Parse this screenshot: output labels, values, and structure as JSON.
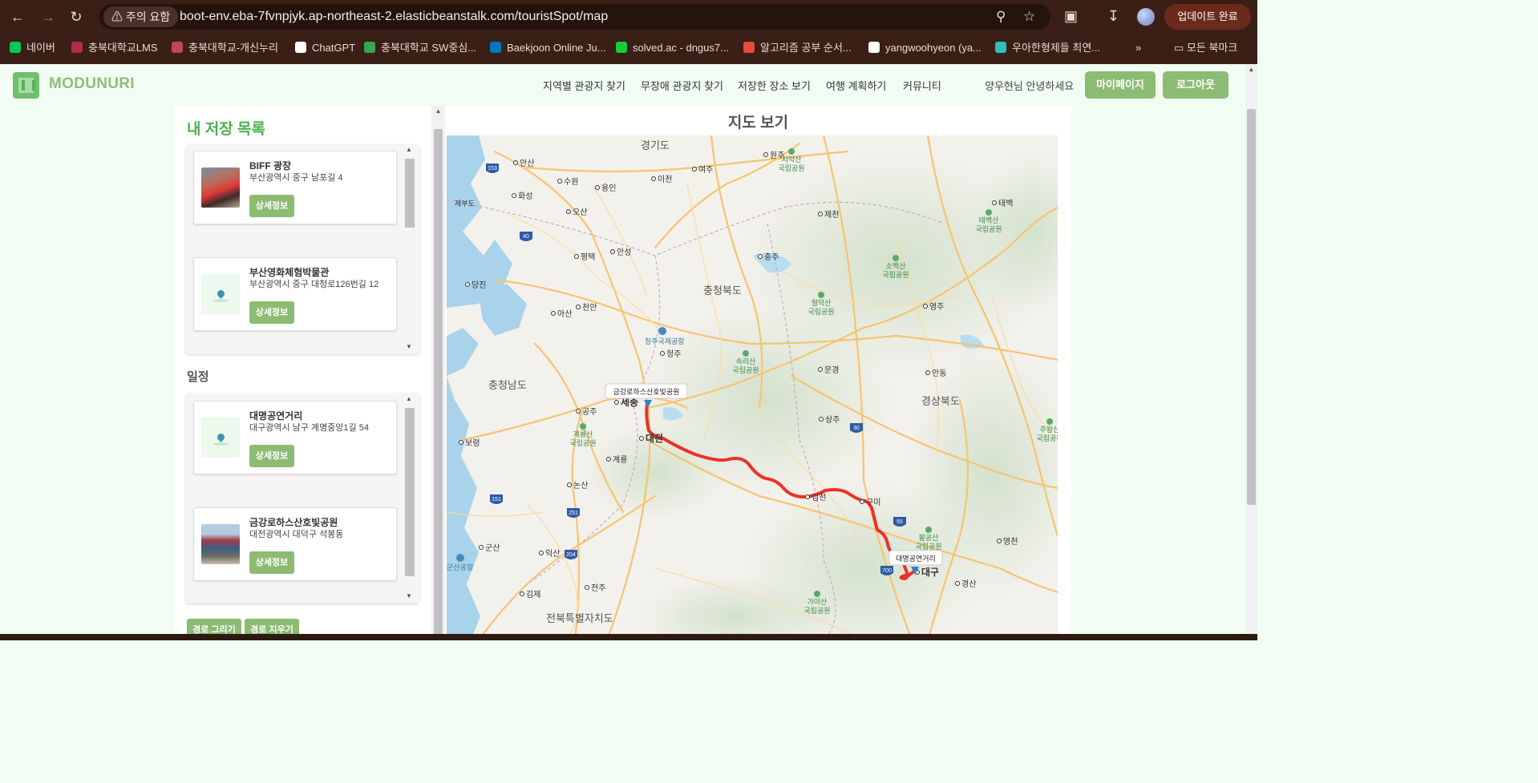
{
  "browser": {
    "warning_chip": "주의 요함",
    "url": "boot-env.eba-7fvnpjyk.ap-northeast-2.elasticbeanstalk.com/touristSpot/map",
    "update_button": "업데이트 완료",
    "bookmarks": [
      {
        "label": "네이버",
        "color": "#03c75a"
      },
      {
        "label": "충북대학교LMS",
        "color": "#b12c4b"
      },
      {
        "label": "충북대학교-개신누리",
        "color": "#c0475c"
      },
      {
        "label": "ChatGPT",
        "color": "#ffffff"
      },
      {
        "label": "충북대학교 SW중심...",
        "color": "#34a853"
      },
      {
        "label": "Baekjoon Online Ju...",
        "color": "#0076c0"
      },
      {
        "label": "solved.ac - dngus7...",
        "color": "#17ce3a"
      },
      {
        "label": "알고리즘 공부 순서...",
        "color": "#e84a3c"
      },
      {
        "label": "yangwoohyeon (ya...",
        "color": "#ffffff"
      },
      {
        "label": "우아한형제들 최연...",
        "color": "#2ac1bc"
      }
    ],
    "all_bookmarks": "모든 북마크"
  },
  "header": {
    "logo": "MODUNURI",
    "nav": [
      "지역별 관광지 찾기",
      "무장애 관광지 찾기",
      "저장한 장소 보기",
      "여행 계획하기",
      "커뮤니티"
    ],
    "greeting": "양우현님 안녕하세요",
    "mypage_button": "마이페이지",
    "logout_button": "로그아웃"
  },
  "saved": {
    "title": "내 저장 목록",
    "items": [
      {
        "name": "BIFF 광장",
        "address": "부산광역시 중구 남포길 4",
        "button": "상세정보"
      },
      {
        "name": "부산영화체험박물관",
        "address": "부산광역시 중구 대청로126번길 12",
        "button": "상세정보"
      }
    ]
  },
  "schedule": {
    "title": "일정",
    "items": [
      {
        "name": "대명공연거리",
        "address": "대구광역시 남구 계명중앙1길 54",
        "button": "상세정보"
      },
      {
        "name": "금강로하스산호빛공원",
        "address": "대전광역시 대덕구 석봉동",
        "button": "상세정보"
      }
    ]
  },
  "route_buttons": {
    "draw": "경로 그리기",
    "clear": "경로 지우기"
  },
  "map": {
    "title": "지도 보기",
    "regions": [
      "경기도",
      "충청북도",
      "충청남도",
      "경상북도",
      "전북특별자치도"
    ],
    "cities": [
      "안산",
      "화성",
      "수원",
      "용인",
      "이천",
      "여주",
      "원주",
      "오산",
      "제천",
      "평택",
      "안성",
      "충주",
      "당진",
      "아산",
      "천안",
      "청주",
      "영주",
      "공주",
      "세종",
      "대전",
      "문경",
      "상주",
      "안동",
      "보령",
      "계룡",
      "논산",
      "김천",
      "구미",
      "군산",
      "익산",
      "전주",
      "김제",
      "대구",
      "경산",
      "영천",
      "태백"
    ],
    "parks": [
      "치악산 국립공원",
      "태백산 국립공원",
      "소백산 국립공원",
      "월악산 국립공원",
      "속리산 국립공원",
      "계룡산 국립공원",
      "팔공산 국립공원",
      "가야산 국립공원",
      "주왕산 국립공원"
    ],
    "airports": [
      "청주국제공항",
      "군산공항"
    ],
    "other_labels": [
      "제부도"
    ],
    "highways": [
      "153",
      "40",
      "151",
      "251",
      "204",
      "30",
      "55",
      "700"
    ],
    "markers": [
      {
        "label": "금강로하스산호빛공원"
      },
      {
        "label": "대명공연거리"
      }
    ],
    "route_color": "#e8332a"
  }
}
